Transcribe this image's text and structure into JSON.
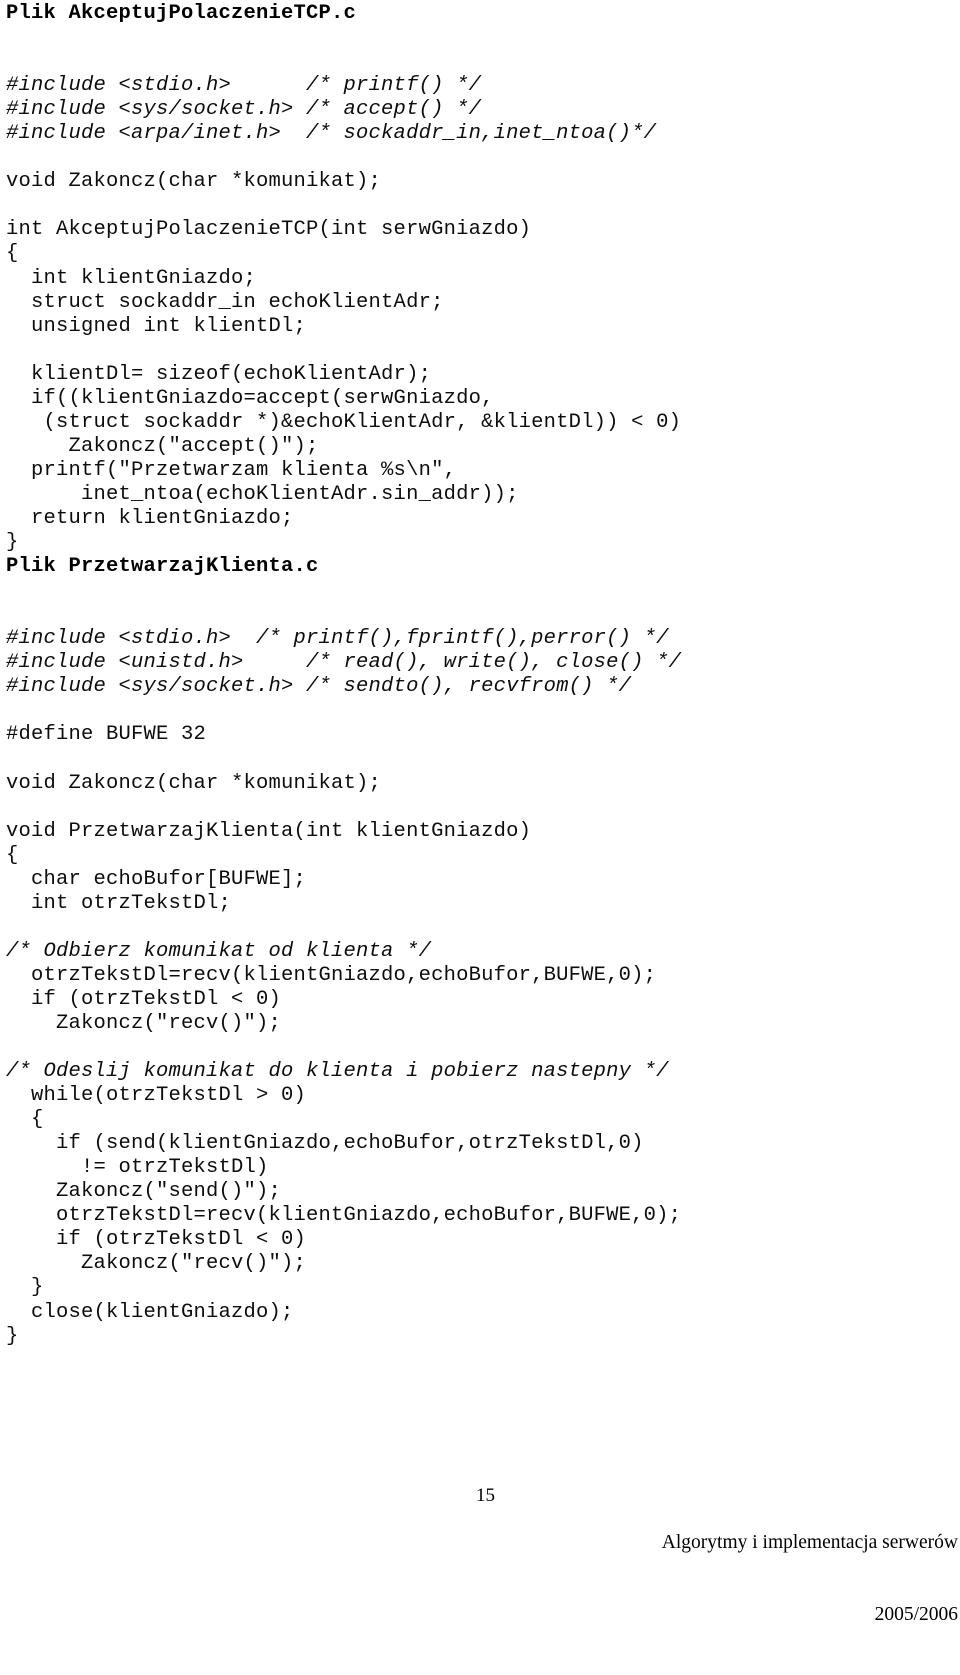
{
  "document": {
    "page_number": "15",
    "footer_title": "Algorytmy i implementacja serwerów",
    "footer_year": "2005/2006"
  },
  "sections": [
    {
      "heading": "Plik AkceptujPolaczenieTCP.c",
      "lines": [
        "",
        "",
        "#include <stdio.h>      /* printf() */",
        "#include <sys/socket.h> /* accept() */",
        "#include <arpa/inet.h>  /* sockaddr_in,inet_ntoa()*/",
        "",
        "void Zakoncz(char *komunikat);",
        "",
        "int AkceptujPolaczenieTCP(int serwGniazdo)",
        "{",
        "  int klientGniazdo;",
        "  struct sockaddr_in echoKlientAdr;",
        "  unsigned int klientDl;",
        "",
        "  klientDl= sizeof(echoKlientAdr);",
        "  if((klientGniazdo=accept(serwGniazdo,",
        "   (struct sockaddr *)&echoKlientAdr, &klientDl)) < 0)",
        "     Zakoncz(\"accept()\");",
        "  printf(\"Przetwarzam klienta %s\\n\",",
        "      inet_ntoa(echoKlientAdr.sin_addr));",
        "  return klientGniazdo;",
        "}"
      ]
    },
    {
      "heading": "Plik PrzetwarzajKlienta.c",
      "lines": [
        "",
        "",
        "#include <stdio.h>  /* printf(),fprintf(),perror() */",
        "#include <unistd.h>     /* read(), write(), close() */",
        "#include <sys/socket.h> /* sendto(), recvfrom() */",
        "",
        "#define BUFWE 32",
        "",
        "void Zakoncz(char *komunikat);",
        "",
        "void PrzetwarzajKlienta(int klientGniazdo)",
        "{",
        "  char echoBufor[BUFWE];",
        "  int otrzTekstDl;",
        "",
        "/* Odbierz komunikat od klienta */",
        "  otrzTekstDl=recv(klientGniazdo,echoBufor,BUFWE,0);",
        "  if (otrzTekstDl < 0)",
        "    Zakoncz(\"recv()\");",
        "",
        "/* Odeslij komunikat do klienta i pobierz nastepny */",
        "  while(otrzTekstDl > 0)",
        "  {",
        "    if (send(klientGniazdo,echoBufor,otrzTekstDl,0)",
        "      != otrzTekstDl)",
        "    Zakoncz(\"send()\");",
        "    otrzTekstDl=recv(klientGniazdo,echoBufor,BUFWE,0);",
        "    if (otrzTekstDl < 0)",
        "      Zakoncz(\"recv()\");",
        "  }",
        "  close(klientGniazdo);",
        "}"
      ]
    }
  ],
  "italic_comment_lines": {
    "0": [
      2,
      3,
      4
    ],
    "1": [
      2,
      3,
      4,
      15,
      20
    ]
  },
  "colors": {
    "text": "#0d0d0d",
    "background": "#ffffff"
  }
}
